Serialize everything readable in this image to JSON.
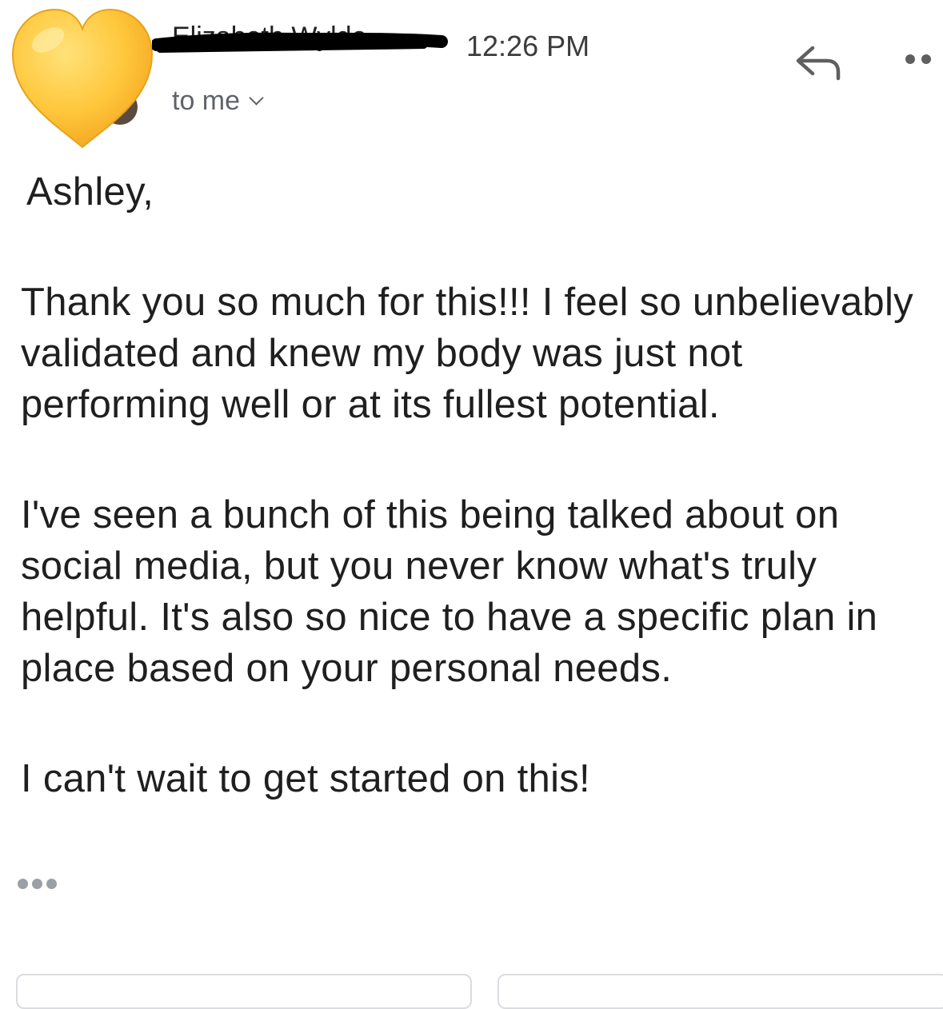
{
  "message": {
    "sender_name": "Elizabeth Wylde",
    "time": "12:26 PM",
    "recipient_label": "to me",
    "avatar_icon": "yellow-heart-emoji",
    "greeting": "Ashley,",
    "paragraphs": [
      "Thank you so much for this!!! I feel so unbelievably validated and knew my body was just not performing well or at its fullest potential.",
      "I've seen a bunch of this being talked about on social media, but you never know what's truly helpful. It's also so nice to have a specific plan in place based on your personal needs.",
      "I can't wait to get started on this!"
    ]
  },
  "icons": {
    "reply": "reply-arrow-icon",
    "more": "more-options-icon",
    "trimmed": "show-trimmed-content-icon"
  },
  "colors": {
    "heart_fill": "#FFC83D",
    "heart_shade": "#F2A41E",
    "redaction": "#000000",
    "secondary_text": "#5f6368"
  }
}
